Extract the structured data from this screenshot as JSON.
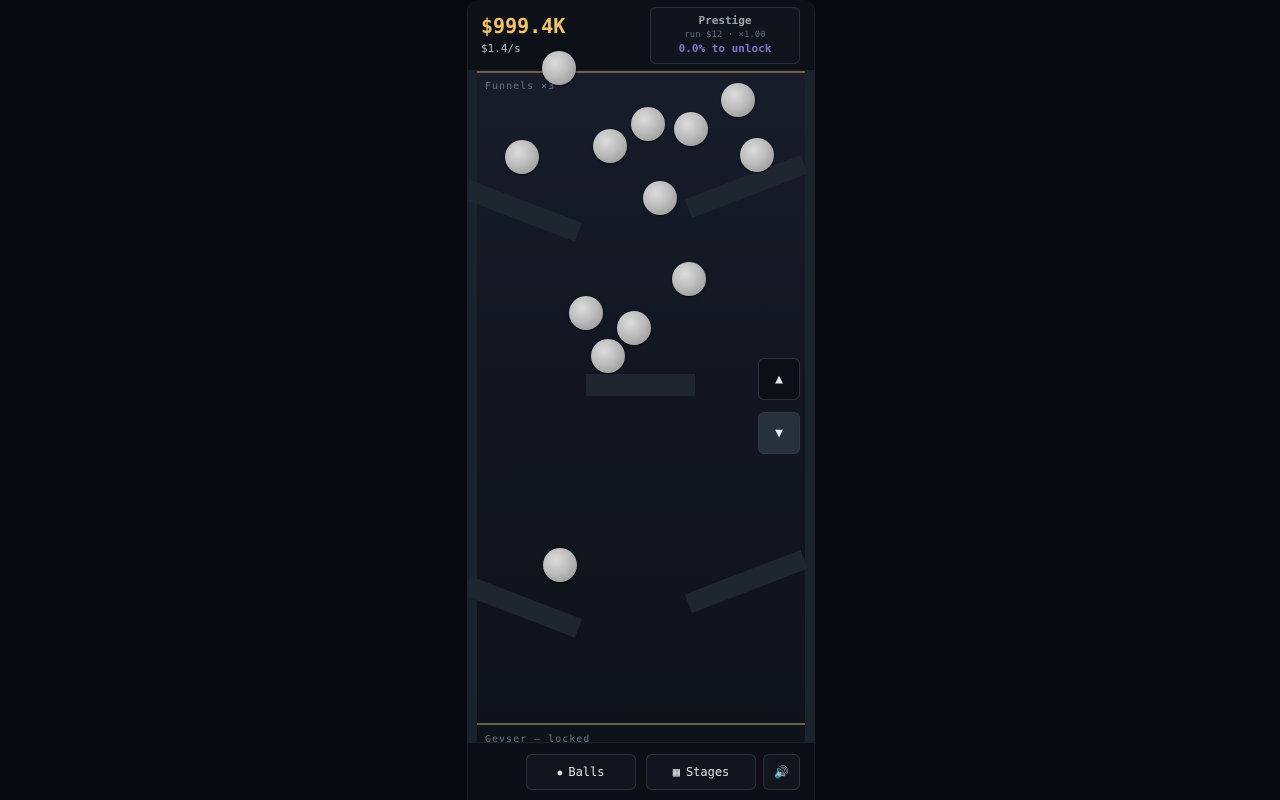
{
  "header": {
    "money": "$999.4K",
    "rate": "$1.4/s"
  },
  "prestige": {
    "title": "Prestige",
    "run": "run $12 · ×1.00",
    "unlock": "0.0% to unlock"
  },
  "board": {
    "stage_top_label": "Funnels ×3",
    "stage_bottom_label": "Geyser — locked",
    "ball_count": 14
  },
  "controls": {
    "up_icon": "▲",
    "down_icon": "▼"
  },
  "footer": {
    "balls_icon": "●",
    "balls_label": "Balls",
    "stages_icon": "▦",
    "stages_label": "Stages",
    "sound_icon": "🔊"
  },
  "colors": {
    "money": "#f4c361",
    "prestige_unlock": "#8572c3",
    "ball": "#c8c8c8",
    "stage_divider": "#6e6046"
  }
}
